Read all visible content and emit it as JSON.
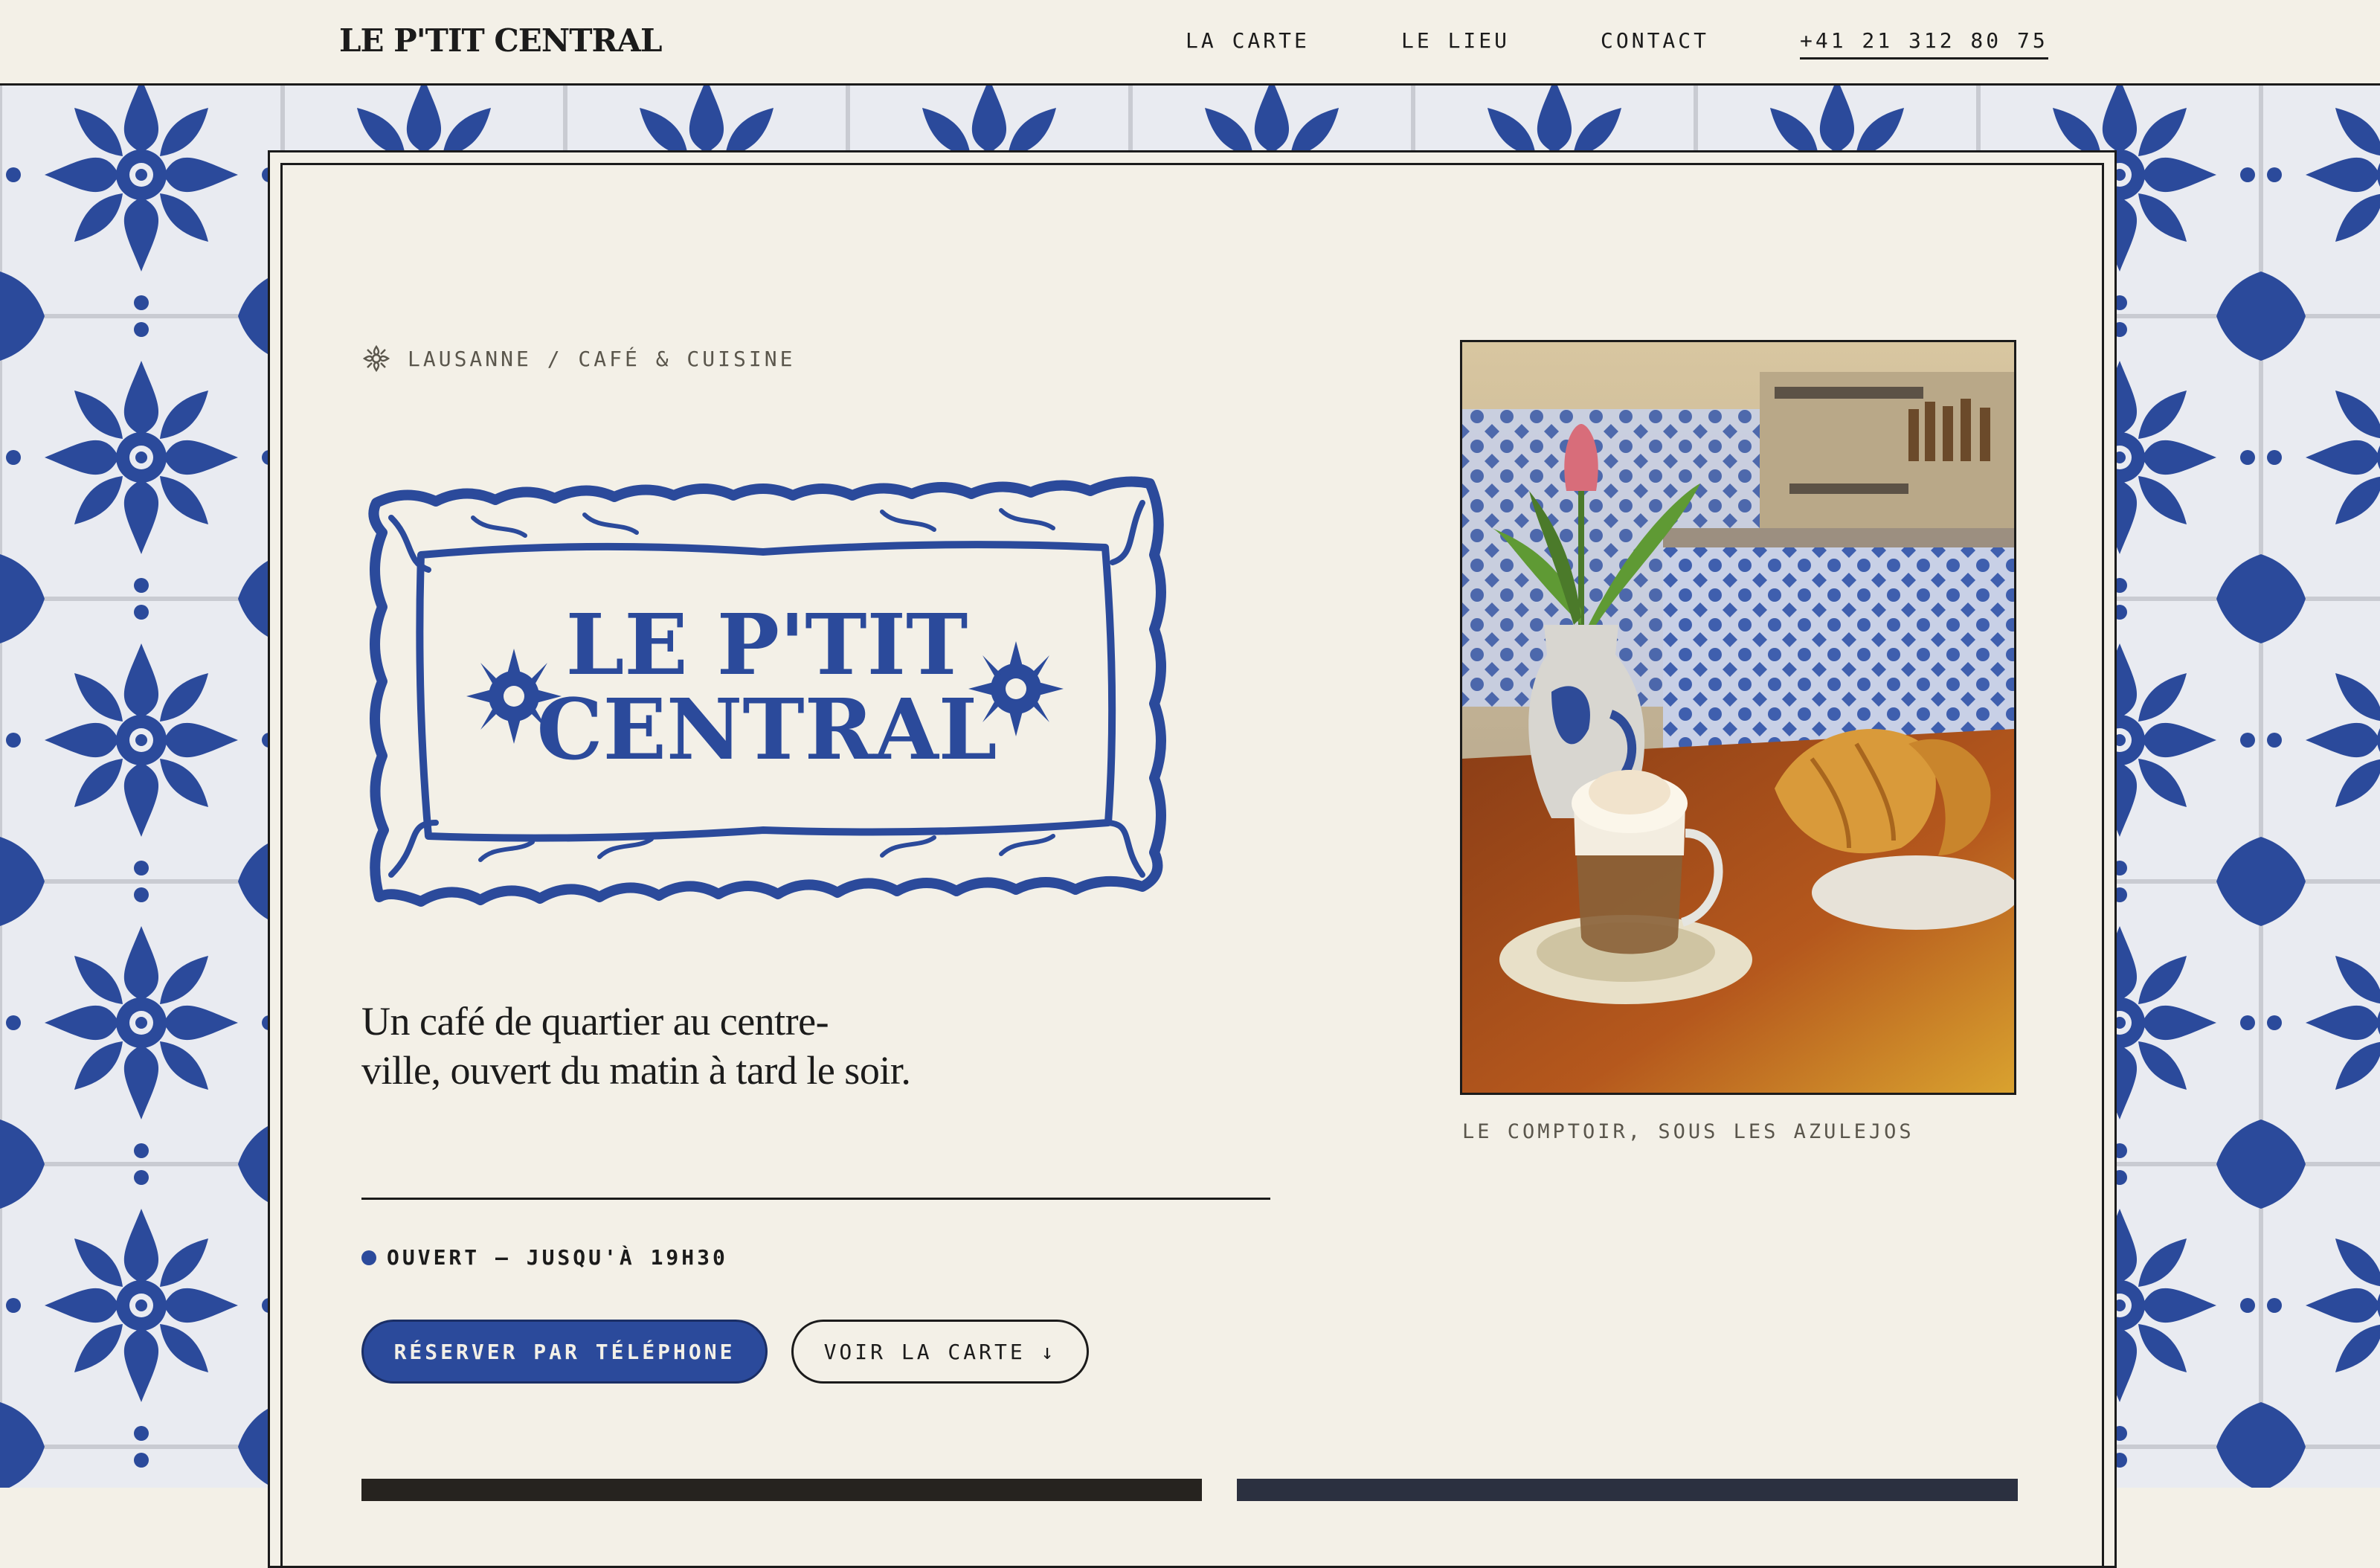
{
  "nav": {
    "brand": "LE P'TIT CENTRAL",
    "links": [
      "LA CARTE",
      "LE LIEU",
      "CONTACT"
    ],
    "phone": "+41 21 312 80 75"
  },
  "hero": {
    "eyebrow": "LAUSANNE / CAFÉ & CUISINE",
    "logo_text_line1": "LE P'TIT",
    "logo_text_line2": "CENTRAL",
    "tagline_line1": "Un café de quartier au centre-",
    "tagline_line2": "ville, ouvert du matin à tard le soir.",
    "status": "OUVERT — JUSQU'À 19H30",
    "primary_button": "RÉSERVER PAR TÉLÉPHONE",
    "secondary_button": "VOIR LA CARTE ↓"
  },
  "photo": {
    "caption": "LE COMPTOIR, SOUS LES AZULEJOS"
  },
  "colors": {
    "cream": "#f3f0e7",
    "ink": "#1b1b1b",
    "azulejo_blue": "#2b4a9b",
    "muted": "#5a564c"
  },
  "icons": {
    "eyebrow": "flower-icon",
    "status": "status-dot-icon",
    "secondary_button": "arrow-down-icon"
  }
}
